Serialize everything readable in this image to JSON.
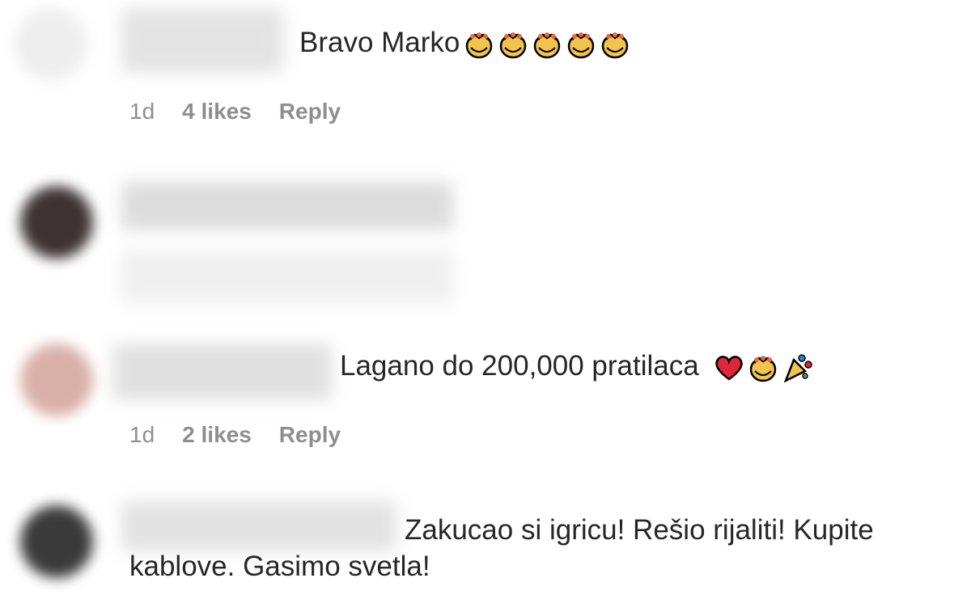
{
  "comments": [
    {
      "text": "Bravo Marko",
      "meta": {
        "age": "1d",
        "likes": "4 likes",
        "reply": "Reply"
      },
      "emojis": [
        "clapping-hands-icon",
        "clapping-hands-icon",
        "clapping-hands-icon",
        "clapping-hands-icon",
        "clapping-hands-icon"
      ]
    },
    {
      "text": "",
      "meta": null,
      "emojis": []
    },
    {
      "text": "Lagano do 200,000 pratilaca",
      "meta": {
        "age": "1d",
        "likes": "2 likes",
        "reply": "Reply"
      },
      "emojis": [
        "red-heart-icon",
        "clapping-hands-icon",
        "party-popper-icon"
      ]
    },
    {
      "text_line1": "Zakucao si igricu! Rešio rijaliti! Kupite",
      "text_line2": "kablove. Gasimo svetla!",
      "meta": null,
      "emojis": []
    }
  ]
}
